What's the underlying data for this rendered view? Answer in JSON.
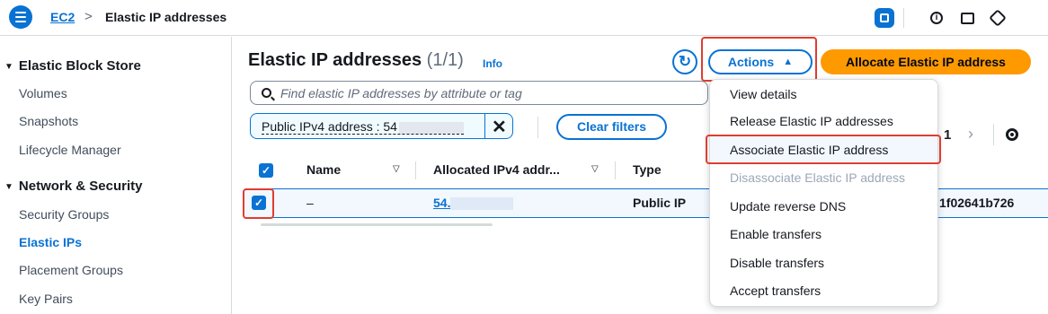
{
  "breadcrumb": {
    "service": "EC2",
    "separator": ">",
    "current": "Elastic IP addresses"
  },
  "header_icons": [
    "cloudshell-icon",
    "info-icon",
    "feedback-icon",
    "settings-icon"
  ],
  "sidebar": {
    "sections": [
      {
        "title": "Elastic Block Store",
        "items": [
          "Volumes",
          "Snapshots",
          "Lifecycle Manager"
        ]
      },
      {
        "title": "Network & Security",
        "items": [
          "Security Groups",
          "Elastic IPs",
          "Placement Groups",
          "Key Pairs"
        ]
      }
    ],
    "active_item": "Elastic IPs"
  },
  "main": {
    "title": "Elastic IP addresses",
    "count": "(1/1)",
    "info_link": "Info",
    "actions_label": "Actions",
    "allocate_label": "Allocate Elastic IP address",
    "search_placeholder": "Find elastic IP addresses by attribute or tag",
    "filter_token": "Public IPv4 address : 54",
    "clear_filters_label": "Clear filters",
    "page_number": "1"
  },
  "table": {
    "columns": [
      "Name",
      "Allocated IPv4 addr...",
      "Type"
    ],
    "rows": [
      {
        "name": "–",
        "ip": "54.",
        "type": "Public IP",
        "id_suffix": "1f02641b726",
        "selected": true
      }
    ]
  },
  "actions_menu": {
    "items": [
      "View details",
      "Release Elastic IP addresses",
      "Associate Elastic IP address",
      "Disassociate Elastic IP address",
      "Update reverse DNS",
      "Enable transfers",
      "Disable transfers",
      "Accept transfers"
    ],
    "disabled": [
      "Disassociate Elastic IP address"
    ],
    "highlighted": "Associate Elastic IP address"
  },
  "colors": {
    "accent": "#0972d3",
    "primary_button": "#ff9900",
    "highlight_box": "#e03c31"
  }
}
